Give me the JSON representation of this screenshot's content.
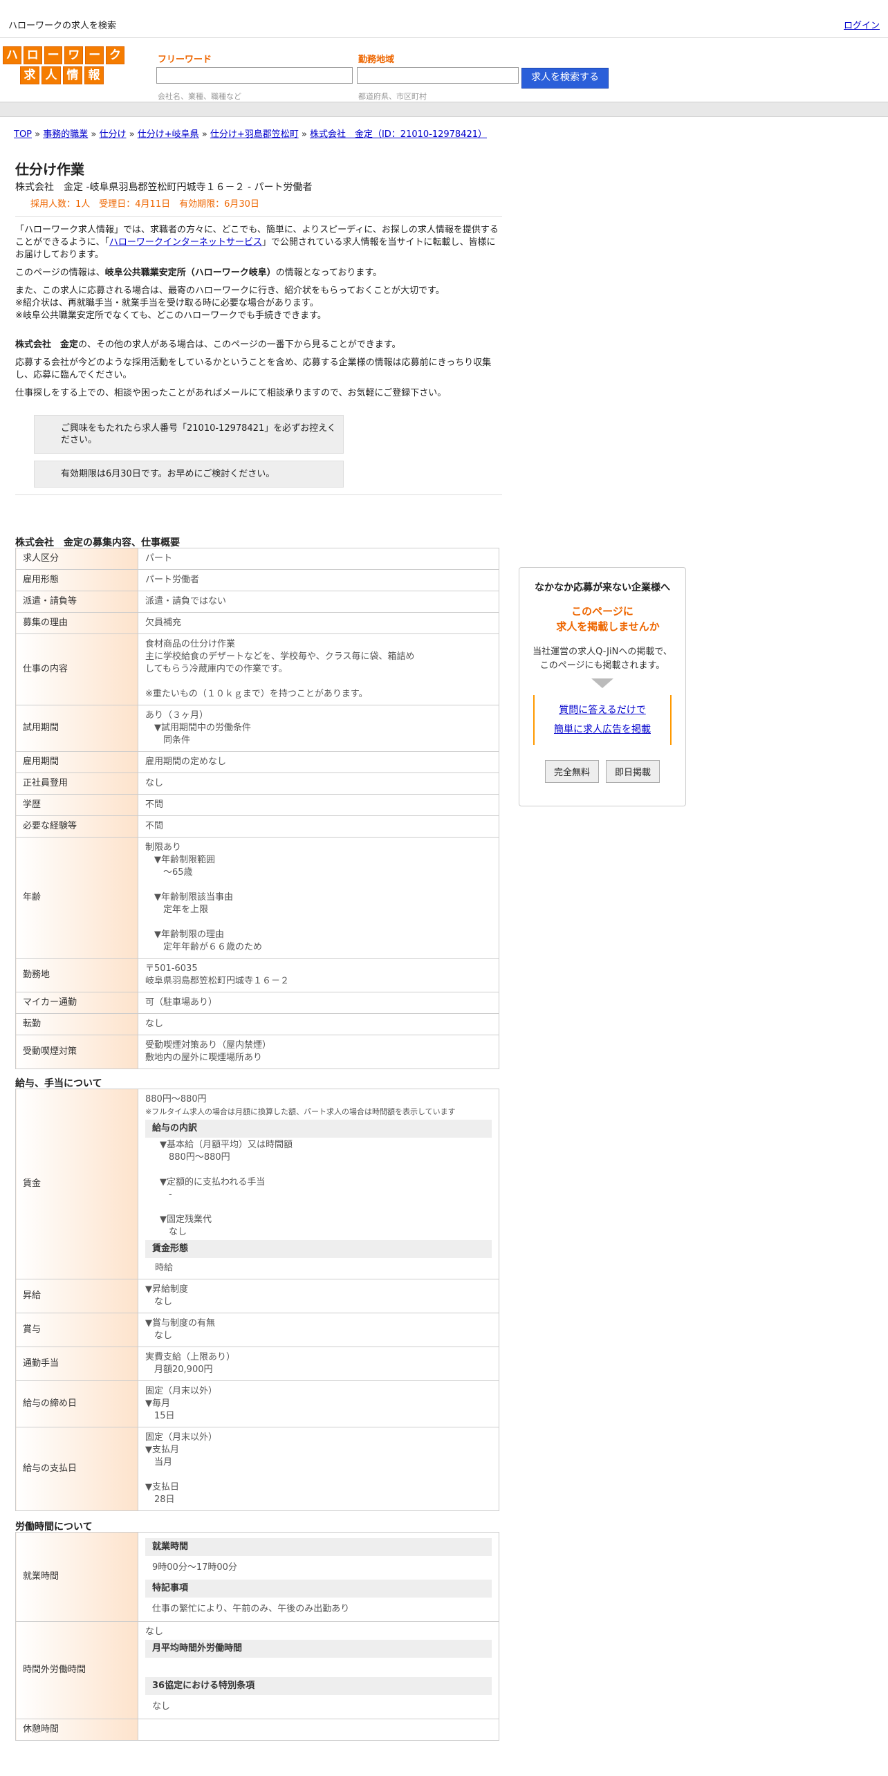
{
  "topbar": {
    "title": "ハローワークの求人を検索",
    "login": "ログイン"
  },
  "logo": {
    "row1": [
      "ハ",
      "ロ",
      "ー",
      "ワ",
      "ー",
      "ク"
    ],
    "row2": [
      "求",
      "人",
      "情",
      "報"
    ]
  },
  "search": {
    "free_label": "フリーワード",
    "free_placeholder": "会社名、業種、職種など",
    "area_label": "勤務地域",
    "area_placeholder": "都道府県、市区町村",
    "button": "求人を検索する"
  },
  "breadcrumb": [
    "TOP",
    "事務的職業",
    "仕分け",
    "仕分け+岐阜県",
    "仕分け+羽島郡笠松町",
    "株式会社　金定（ID：21010-12978421）"
  ],
  "job": {
    "title": "仕分け作業",
    "subtitle": "株式会社　金定 -岐阜県羽島郡笠松町円城寺１６－２ - パート労働者",
    "meta": "採用人数：1人　受理日：4月11日　有効期限：6月30日"
  },
  "intro": {
    "p1a": "「ハローワーク求人情報」では、求職者の方々に、どこでも、簡単に、よりスピーディに、お探しの求人情報を提供することができるように、「",
    "p1link": "ハローワークインターネットサービス",
    "p1b": "」で公開されている求人情報を当サイトに転載し、皆様にお届けしております。",
    "p2a": "このページの情報は、",
    "p2b": "岐阜公共職業安定所（ハローワーク岐阜）",
    "p2c": "の情報となっております。",
    "p3": "また、この求人に応募される場合は、最寄のハローワークに行き、紹介状をもらっておくことが大切です。",
    "p3b": "※紹介状は、再就職手当・就業手当を受け取る時に必要な場合があります。",
    "p3c": "※岐阜公共職業安定所でなくても、どこのハローワークでも手続きできます。",
    "p4a": "株式会社　金定",
    "p4b": "の、その他の求人がある場合は、このページの一番下から見ることができます。",
    "p5": "応募する会社が今どのような採用活動をしているかということを含め、応募する企業様の情報は応募前にきっちり収集し、応募に臨んでください。",
    "p6": "仕事探しをする上での、相談や困ったことがあればメールにて相談承りますので、お気軽にご登録下さい。",
    "box1": "ご興味をもたれたら求人番号「21010-12978421」を必ずお控えください。",
    "box2": "有効期限は6月30日です。お早めにご検討ください。"
  },
  "sec1": {
    "title": "株式会社　金定の募集内容、仕事概要",
    "rows": [
      {
        "k": "求人区分",
        "v": [
          "パート"
        ]
      },
      {
        "k": "雇用形態",
        "v": [
          "パート労働者"
        ]
      },
      {
        "k": "派遣・請負等",
        "v": [
          "派遣・請負ではない"
        ]
      },
      {
        "k": "募集の理由",
        "v": [
          "欠員補充"
        ]
      },
      {
        "k": "仕事の内容",
        "v": [
          "食材商品の仕分け作業",
          "主に学校給食のデザートなどを、学校毎や、クラス毎に袋、箱詰め",
          "してもらう冷蔵庫内での作業です。",
          "",
          "※重たいもの（１０ｋｇまで）を持つことがあります。"
        ]
      },
      {
        "k": "試用期間",
        "v": [
          "あり（３ヶ月）",
          "　▼試用期間中の労働条件",
          "　　同条件"
        ]
      },
      {
        "k": "雇用期間",
        "v": [
          "雇用期間の定めなし"
        ]
      },
      {
        "k": "正社員登用",
        "v": [
          "なし"
        ]
      },
      {
        "k": "学歴",
        "v": [
          "不問"
        ]
      },
      {
        "k": "必要な経験等",
        "v": [
          "不問"
        ]
      },
      {
        "k": "年齢",
        "v": [
          "制限あり",
          "　▼年齢制限範囲",
          "　　〜65歳",
          "",
          "　▼年齢制限該当事由",
          "　　定年を上限",
          "",
          "　▼年齢制限の理由",
          "　　定年年齢が６６歳のため"
        ]
      },
      {
        "k": "勤務地",
        "v": [
          "〒501-6035",
          "岐阜県羽島郡笠松町円城寺１６－２"
        ]
      },
      {
        "k": "マイカー通勤",
        "v": [
          "可（駐車場あり）"
        ]
      },
      {
        "k": "転勤",
        "v": [
          "なし"
        ]
      },
      {
        "k": "受動喫煙対策",
        "v": [
          "受動喫煙対策あり（屋内禁煙）",
          "敷地内の屋外に喫煙場所あり"
        ]
      }
    ]
  },
  "sec2": {
    "title": "給与、手当について",
    "wage_k": "賃金",
    "wage_range": "880円〜880円",
    "wage_note": "※フルタイム求人の場合は月額に換算した額、パート求人の場合は時間額を表示しています",
    "wage_sh1": "給与の内訳",
    "wage_items": [
      "　▼基本給（月額平均）又は時間額",
      "　　880円〜880円",
      "",
      "　▼定額的に支払われる手当",
      "　　-",
      "",
      "　▼固定残業代",
      "　　なし"
    ],
    "wage_sh2": "賃金形態",
    "wage_form": "時給",
    "rows": [
      {
        "k": "昇給",
        "v": [
          "▼昇給制度",
          "　なし"
        ]
      },
      {
        "k": "賞与",
        "v": [
          "▼賞与制度の有無",
          "　なし"
        ]
      },
      {
        "k": "通勤手当",
        "v": [
          "実費支給（上限あり）",
          "　月額20,900円"
        ]
      },
      {
        "k": "給与の締め日",
        "v": [
          "固定（月末以外）",
          "▼毎月",
          "　15日"
        ]
      },
      {
        "k": "給与の支払日",
        "v": [
          "固定（月末以外）",
          "▼支払月",
          "　当月",
          "",
          "▼支払日",
          "　28日"
        ]
      }
    ]
  },
  "sec3": {
    "title": "労働時間について",
    "work_k": "就業時間",
    "work_sh1": "就業時間",
    "work_v1": "9時00分〜17時00分",
    "work_sh2": "特記事項",
    "work_v2": "仕事の繁忙により、午前のみ、午後のみ出勤あり",
    "ot_k": "時間外労働時間",
    "ot_v": "なし",
    "ot_sh1": "月平均時間外労働時間",
    "ot_sh2": "36協定における特別条項",
    "ot_v2": "なし",
    "next_k": "休憩時間"
  },
  "side": {
    "t1": "なかなか応募が来ない企業様へ",
    "t2a": "このページに",
    "t2b": "求人を掲載しませんか",
    "t3a": "当社運営の求人Q-JiNへの掲載で、",
    "t3b": "このページにも掲載されます。",
    "link1": "質問に答えるだけで",
    "link2": "簡単に求人広告を掲載",
    "btn1": "完全無料",
    "btn2": "即日掲載"
  }
}
